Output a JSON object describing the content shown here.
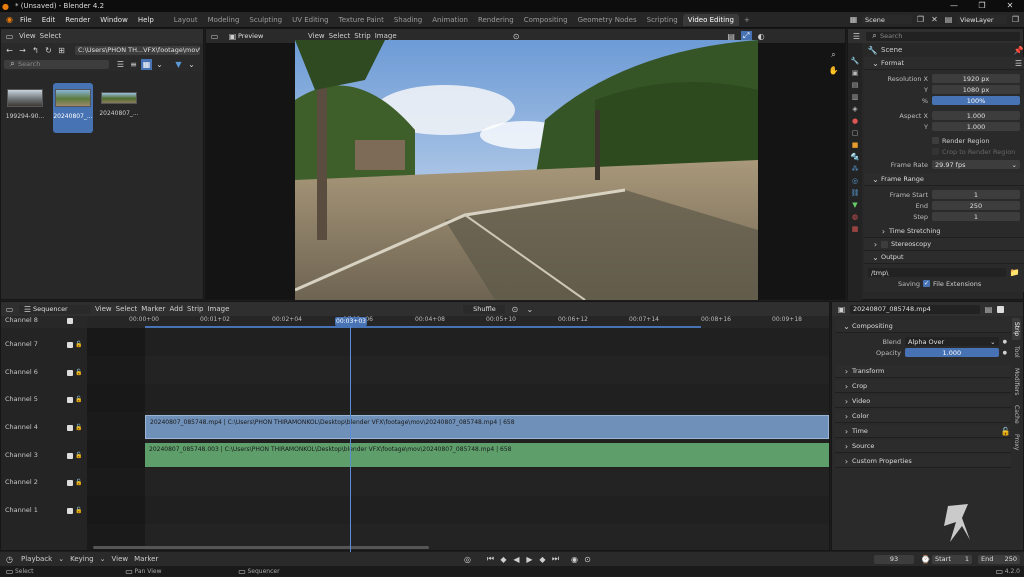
{
  "window": {
    "title": "* (Unsaved) - Blender 4.2",
    "controls": [
      "—",
      "❐",
      "✕"
    ]
  },
  "menubar": {
    "menus": [
      "File",
      "Edit",
      "Render",
      "Window",
      "Help"
    ],
    "workspaces": [
      "Layout",
      "Modeling",
      "Sculpting",
      "UV Editing",
      "Texture Paint",
      "Shading",
      "Animation",
      "Rendering",
      "Compositing",
      "Geometry Nodes",
      "Scripting",
      "Video Editing"
    ],
    "active_workspace": "Video Editing",
    "scene": "Scene",
    "view_layer": "ViewLayer"
  },
  "filebrowser": {
    "menus": [
      "View",
      "Select"
    ],
    "path": "C:\\Users\\PHON TH...VFX\\footage\\mov\\",
    "search_placeholder": "Search",
    "files": [
      {
        "name": "199294-90...",
        "selected": false
      },
      {
        "name": "20240807_...",
        "selected": true
      },
      {
        "name": "20240807_...",
        "selected": false
      }
    ]
  },
  "preview": {
    "mode": "Preview",
    "menus": [
      "View",
      "Select",
      "Strip",
      "Image"
    ]
  },
  "properties": {
    "search_placeholder": "Search",
    "scene_label": "Scene",
    "format": {
      "title": "Format",
      "res_x_label": "Resolution X",
      "res_x": "1920 px",
      "res_y_label": "Y",
      "res_y": "1080 px",
      "pct_label": "%",
      "pct": "100%",
      "aspect_x_label": "Aspect X",
      "aspect_x": "1.000",
      "aspect_y_label": "Y",
      "aspect_y": "1.000",
      "render_region": "Render Region",
      "crop": "Crop to Render Region",
      "fps_label": "Frame Rate",
      "fps": "29.97 fps"
    },
    "frame_range": {
      "title": "Frame Range",
      "start_label": "Frame Start",
      "start": "1",
      "end_label": "End",
      "end": "250",
      "step_label": "Step",
      "step": "1",
      "time_stretching": "Time Stretching"
    },
    "stereoscopy": "Stereoscopy",
    "output": {
      "title": "Output",
      "path": "/tmp\\",
      "saving_label": "Saving",
      "file_ext": "File Extensions"
    }
  },
  "sequencer": {
    "editor": "Sequencer",
    "menus": [
      "View",
      "Select",
      "Marker",
      "Add",
      "Strip",
      "Image"
    ],
    "snap_mode": "Shuffle",
    "current_time": "00:03+03",
    "ticks": [
      "00:00+00",
      "00:01+02",
      "00:02+04",
      "00:03+06",
      "00:04+08",
      "00:05+10",
      "00:06+12",
      "00:07+14",
      "00:08+16",
      "00:09+18"
    ],
    "channels": [
      "Channel 8",
      "Channel 7",
      "Channel 6",
      "Channel 5",
      "Channel 4",
      "Channel 3",
      "Channel 2",
      "Channel 1"
    ],
    "strips": [
      {
        "label": "20240807_085748.mp4 | C:\\Users\\PHON THIRAMONKOL\\Desktop\\blender VFX\\footage\\mov\\20240807_085748.mp4 | 658",
        "color": "#6f90b8"
      },
      {
        "label": "20240807_085748.003 | C:\\Users\\PHON THIRAMONKOL\\Desktop\\blender VFX\\footage\\mov\\20240807_085748.mp4 | 658",
        "color": "#5e9e6a"
      }
    ]
  },
  "sidebar": {
    "strip_name": "20240807_085748.mp4",
    "compositing": "Compositing",
    "blend_label": "Blend",
    "blend": "Alpha Over",
    "opacity_label": "Opacity",
    "opacity": "1.000",
    "sections": [
      "Transform",
      "Crop",
      "Video",
      "Color",
      "Time",
      "Source",
      "Custom Properties"
    ],
    "tabs": [
      "Strip",
      "Tool",
      "Modifiers",
      "Cache",
      "Proxy"
    ]
  },
  "playback": {
    "menus": [
      "Playback",
      "Keying",
      "View",
      "Marker"
    ],
    "frame": "93",
    "start_label": "Start",
    "start": "1",
    "end_label": "End",
    "end": "250"
  },
  "status": {
    "select": "Select",
    "pan": "Pan View",
    "context": "Sequencer",
    "version": "4.2.0"
  }
}
